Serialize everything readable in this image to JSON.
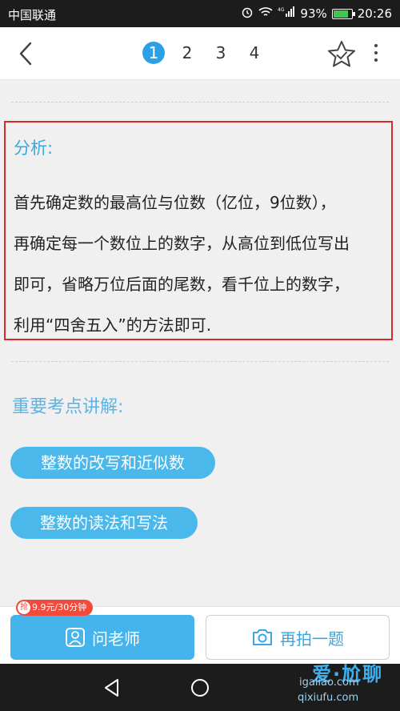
{
  "status_bar": {
    "carrier": "中国联通",
    "network_label": "4G",
    "battery_percent": "93%",
    "battery_level": 0.93,
    "time": "20:26"
  },
  "nav": {
    "pages": [
      "1",
      "2",
      "3",
      "4"
    ],
    "active_page": "1"
  },
  "analysis": {
    "title": "分析:",
    "lines": [
      "首先确定数的最高位与位数（亿位，9位数），",
      "再确定每一个数位上的数字，从高位到低位写出",
      "即可，省略万位后面的尾数，看千位上的数字，",
      "利用“四舍五入”的方法即可."
    ]
  },
  "key_points": {
    "title": "重要考点讲解:",
    "topics": [
      "整数的改写和近似数",
      "整数的读法和写法"
    ]
  },
  "actions": {
    "promo_coin": "抢",
    "promo_label": "9.9元/30分钟",
    "ask_teacher": "问老师",
    "photo_question": "再拍一题"
  },
  "watermark": {
    "text": "爱·尬聊",
    "url1": "igaliao.com",
    "url2": "qixiufu.com"
  },
  "colors": {
    "accent": "#2aa1e6",
    "highlight_border": "#d9282c",
    "button_blue": "#45b4ec"
  }
}
